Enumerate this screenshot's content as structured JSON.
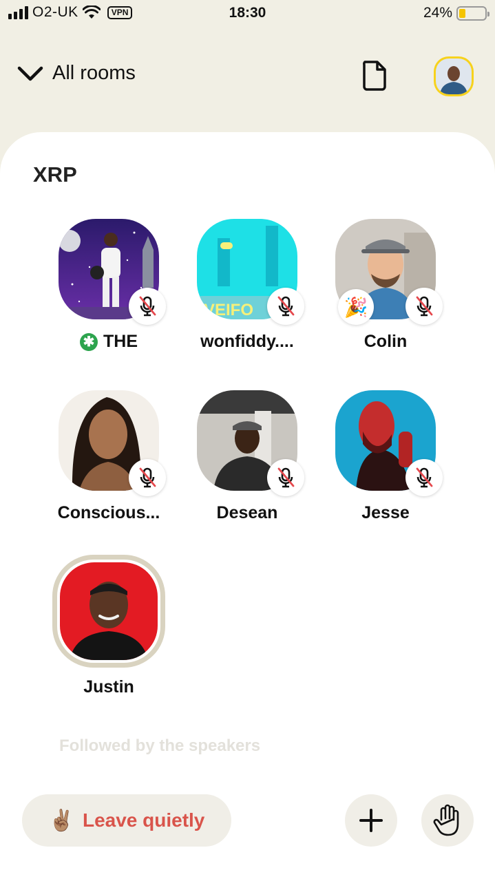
{
  "status_bar": {
    "carrier": "O2-UK",
    "vpn": "VPN",
    "time": "18:30",
    "battery_percent": "24%",
    "battery_level": 0.24,
    "battery_color": "#f5c400"
  },
  "header": {
    "all_rooms_label": "All rooms",
    "chevron_icon": "chevron-down-icon",
    "document_icon": "document-icon"
  },
  "room": {
    "title": "XRP",
    "speakers": [
      {
        "name": "THE",
        "moderator_icon": "green-asterisk-icon",
        "muted": true
      },
      {
        "name": "wonfiddy....",
        "muted": true
      },
      {
        "name": "Colin",
        "badge": "party-popper-icon",
        "muted": true
      },
      {
        "name": "Conscious...",
        "muted": true
      },
      {
        "name": "Desean",
        "muted": true
      },
      {
        "name": "Jesse",
        "muted": true
      },
      {
        "name": "Justin",
        "speaking": true
      }
    ],
    "followed_label": "Followed by the speakers"
  },
  "bottom_bar": {
    "leave_emoji": "✌🏽",
    "leave_label": "Leave quietly",
    "leave_color": "#d9544b",
    "add_icon": "plus-icon",
    "raise_hand_icon": "raise-hand-icon"
  }
}
